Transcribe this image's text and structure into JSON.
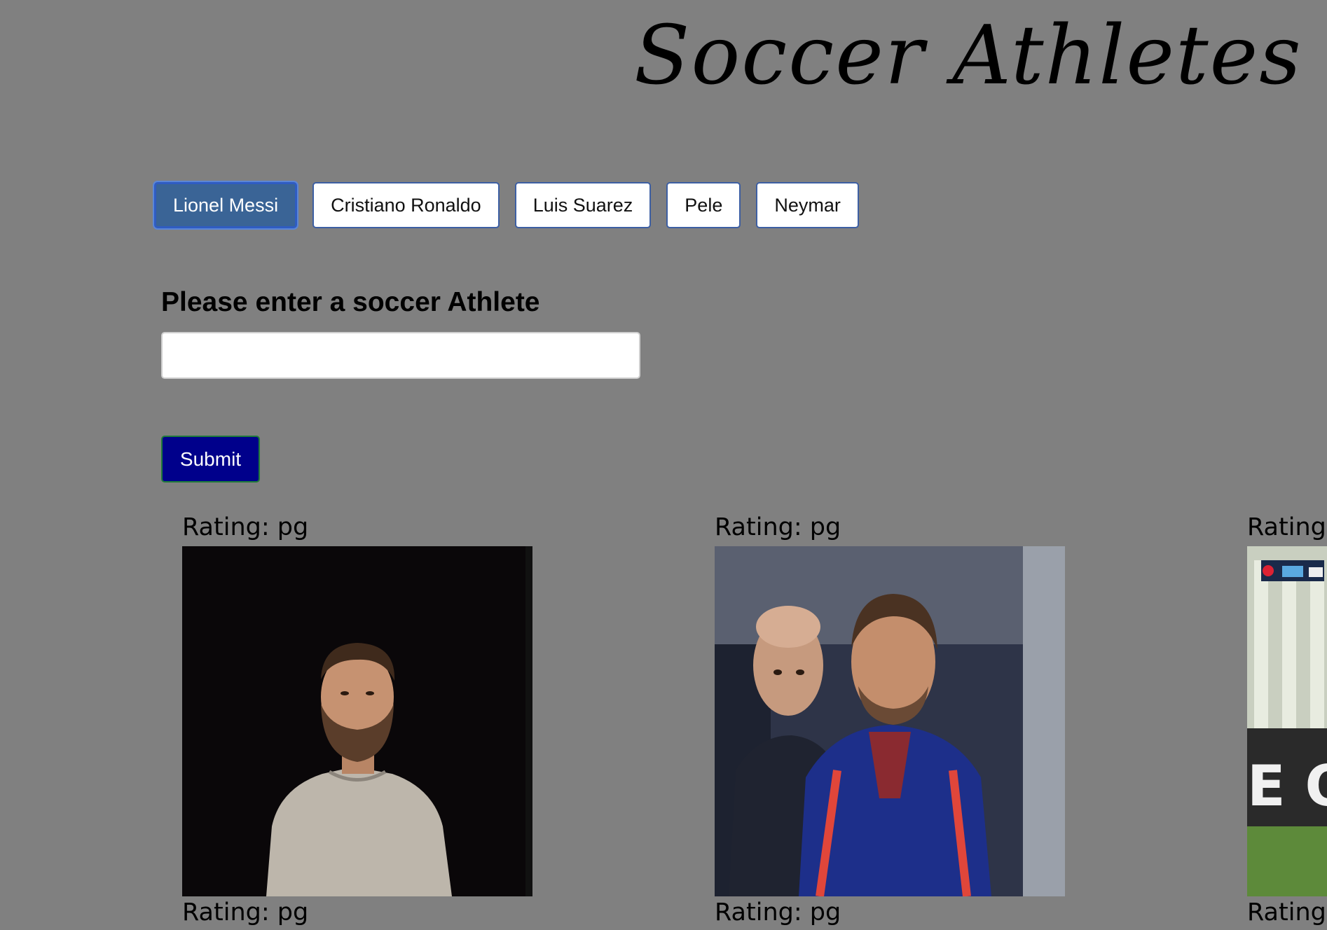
{
  "header": {
    "title": "Soccer Athletes"
  },
  "athlete_buttons": [
    {
      "label": "Lionel Messi",
      "active": true
    },
    {
      "label": "Cristiano Ronaldo",
      "active": false
    },
    {
      "label": "Luis Suarez",
      "active": false
    },
    {
      "label": "Pele",
      "active": false
    },
    {
      "label": "Neymar",
      "active": false
    }
  ],
  "form": {
    "label": "Please enter a soccer Athlete",
    "input_value": "",
    "input_placeholder": "",
    "submit_label": "Submit"
  },
  "gifs": [
    {
      "rating_label": "Rating: pg",
      "bottom_rating_label": "Rating: pg",
      "image_icon": "messi-portrait-black-background"
    },
    {
      "rating_label": "Rating: pg",
      "bottom_rating_label": "Rating: pg",
      "image_icon": "messi-on-bench"
    },
    {
      "rating_label": "Rating: pg",
      "bottom_rating_label": "Rating: pg",
      "image_icon": "stadium-broadcast-scene"
    }
  ],
  "colors": {
    "background": "#808080",
    "active_button": "#3a6496",
    "submit_button": "#00008b"
  }
}
